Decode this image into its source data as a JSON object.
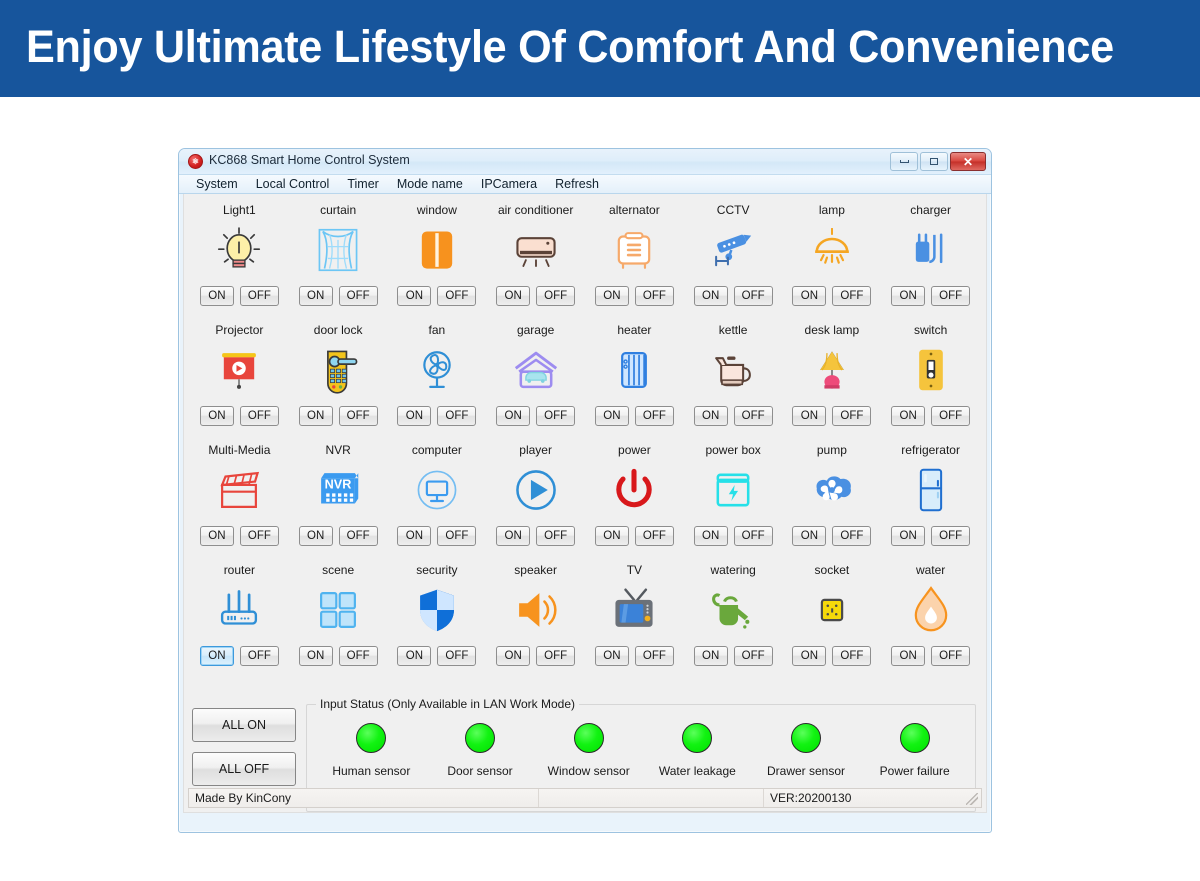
{
  "banner": {
    "title": "Enjoy Ultimate Lifestyle Of Comfort And Convenience",
    "bg": "#17559c",
    "color": "#ffffff"
  },
  "window": {
    "title": "KC868 Smart Home Control System",
    "app_icon": "kc-logo-icon",
    "controls": {
      "minimize": "–",
      "maximize": "□",
      "close": "✕"
    }
  },
  "menu": {
    "items": [
      "System",
      "Local Control",
      "Timer",
      "Mode name",
      "IPCamera",
      "Refresh"
    ]
  },
  "buttons": {
    "on": "ON",
    "off": "OFF",
    "all_on": "ALL ON",
    "all_off": "ALL OFF"
  },
  "devices": [
    [
      {
        "label": "Light1",
        "icon": "bulb-icon"
      },
      {
        "label": "curtain",
        "icon": "curtain-icon"
      },
      {
        "label": "window",
        "icon": "window-icon"
      },
      {
        "label": "air conditioner",
        "icon": "air-conditioner-icon"
      },
      {
        "label": "alternator",
        "icon": "alternator-icon"
      },
      {
        "label": "CCTV",
        "icon": "cctv-icon"
      },
      {
        "label": "lamp",
        "icon": "pendant-lamp-icon"
      },
      {
        "label": "charger",
        "icon": "charger-icon"
      }
    ],
    [
      {
        "label": "Projector",
        "icon": "projector-icon"
      },
      {
        "label": "door lock",
        "icon": "door-lock-icon"
      },
      {
        "label": "fan",
        "icon": "fan-icon"
      },
      {
        "label": "garage",
        "icon": "garage-icon"
      },
      {
        "label": "heater",
        "icon": "heater-icon"
      },
      {
        "label": "kettle",
        "icon": "kettle-icon"
      },
      {
        "label": "desk lamp",
        "icon": "desk-lamp-icon"
      },
      {
        "label": "switch",
        "icon": "switch-icon"
      }
    ],
    [
      {
        "label": "Multi-Media",
        "icon": "clapperboard-icon"
      },
      {
        "label": "NVR",
        "icon": "nvr-icon"
      },
      {
        "label": "computer",
        "icon": "computer-icon"
      },
      {
        "label": "player",
        "icon": "play-icon"
      },
      {
        "label": "power",
        "icon": "power-icon"
      },
      {
        "label": "power box",
        "icon": "power-box-icon"
      },
      {
        "label": "pump",
        "icon": "pump-icon"
      },
      {
        "label": "refrigerator",
        "icon": "refrigerator-icon"
      }
    ],
    [
      {
        "label": "router",
        "icon": "router-icon"
      },
      {
        "label": "scene",
        "icon": "scene-icon"
      },
      {
        "label": "security",
        "icon": "shield-icon"
      },
      {
        "label": "speaker",
        "icon": "speaker-icon"
      },
      {
        "label": "TV",
        "icon": "tv-icon"
      },
      {
        "label": "watering",
        "icon": "watering-can-icon"
      },
      {
        "label": "socket",
        "icon": "socket-icon"
      },
      {
        "label": "water",
        "icon": "water-drop-icon"
      }
    ]
  ],
  "focused_button": {
    "row": 3,
    "col": 0,
    "which": "on"
  },
  "input_status": {
    "title": "Input Status (Only Available in LAN Work Mode)",
    "led_color": "#00e000",
    "sensors": [
      "Human sensor",
      "Door sensor",
      "Window sensor",
      "Water leakage",
      "Drawer sensor",
      "Power failure"
    ]
  },
  "statusbar": {
    "left": "Made By KinCony",
    "middle": "",
    "right": "VER:20200130"
  }
}
